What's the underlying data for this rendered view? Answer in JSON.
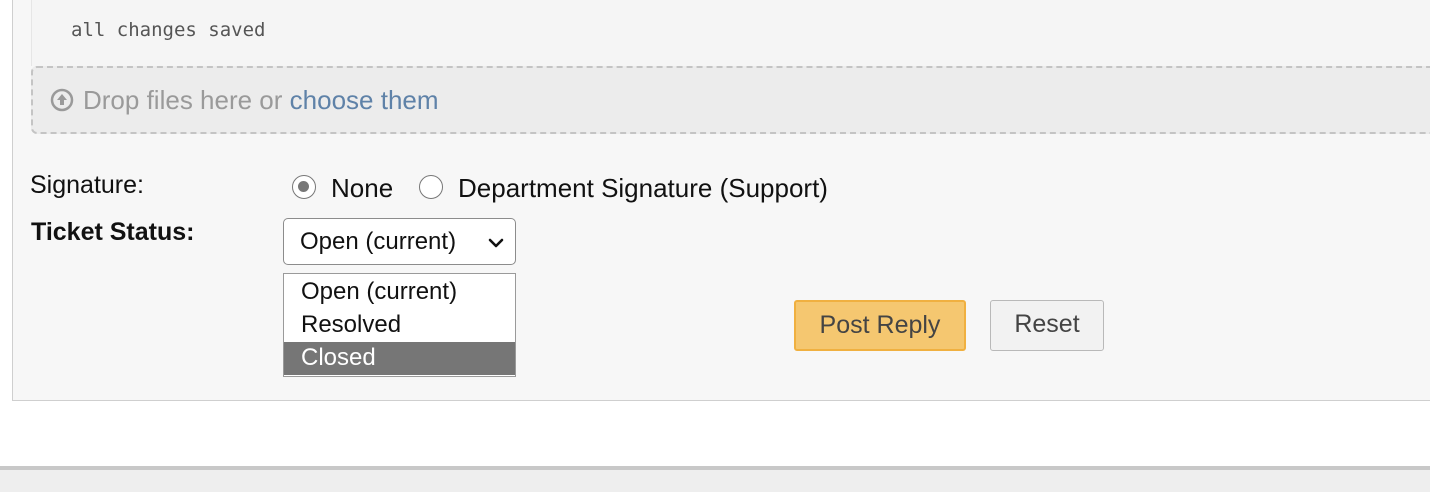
{
  "editor": {
    "save_status": "all changes saved"
  },
  "attachments": {
    "icon": "upload-circle-icon",
    "drop_text": "Drop files here or ",
    "choose_link": "choose them"
  },
  "signature": {
    "label": "Signature:",
    "options": [
      {
        "label": "None",
        "checked": true
      },
      {
        "label": "Department Signature (Support)",
        "checked": false
      }
    ]
  },
  "ticket_status": {
    "label": "Ticket Status:",
    "selected": "Open (current)",
    "options": [
      {
        "label": "Open (current)",
        "highlighted": false
      },
      {
        "label": "Resolved",
        "highlighted": false
      },
      {
        "label": "Closed",
        "highlighted": true
      }
    ]
  },
  "actions": {
    "post_reply": "Post Reply",
    "reset": "Reset"
  },
  "colors": {
    "primary_button_bg": "#f5c770",
    "primary_button_border": "#f0b040",
    "highlight": "#767676",
    "link": "#5f82a8"
  }
}
